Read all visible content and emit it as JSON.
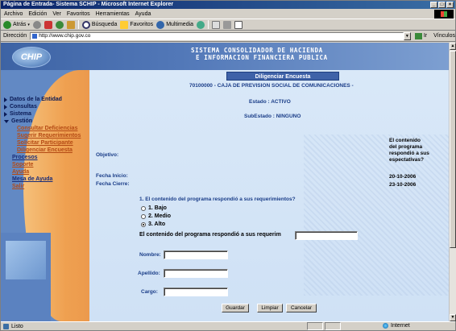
{
  "window": {
    "title": "Página de Entrada- Sistema SCHIP - Microsoft Internet Explorer"
  },
  "menu": [
    "Archivo",
    "Edición",
    "Ver",
    "Favoritos",
    "Herramientas",
    "Ayuda"
  ],
  "toolbar": {
    "back": "Atrás",
    "search": "Búsqueda",
    "favorites": "Favoritos",
    "multimedia": "Multimedia"
  },
  "address": {
    "label": "Dirección",
    "url": "http://www.chip.gov.co",
    "go": "Ir",
    "links": "Vínculos"
  },
  "header": {
    "logo": "CHIP",
    "title_line1": "SISTEMA CONSOLIDADOR DE HACIENDA",
    "title_line2": "E INFORMACION FINANCIERA PUBLICA"
  },
  "nav": {
    "items": [
      "Datos de la Entidad",
      "Consultas",
      "Sistema",
      "Gestión"
    ],
    "sub": [
      "Consultar Deficiencias",
      "Sugerir Requerimientos",
      "Solicitar Participante",
      "Diligenciar Encuesta"
    ],
    "links": [
      "Procesos",
      "Soporte",
      "Ayuda",
      "Mesa de Ayuda",
      "Salir"
    ]
  },
  "form": {
    "tab": "Diligenciar Encuesta",
    "entity": "70100000 - CAJA DE PREVISION SOCIAL DE COMUNICACIONES -",
    "estado": "Estado : ACTIVO",
    "subestado": "SubEstado : NINGUNO",
    "objetivo_label": "Objetivo:",
    "fecha_inicio_label": "Fecha Inicio:",
    "fecha_cierre_label": "Fecha Cierre:",
    "objetivo_value": "El contenido del programa respondió a sus espectativas?",
    "fecha_inicio_value": "20-10-2006",
    "fecha_cierre_value": "23-10-2006",
    "question": "1. El contenido del programa respondió a sus requerimientos?",
    "options": [
      "1. Bajo",
      "2. Medio",
      "3. Alto"
    ],
    "selected_option": 2,
    "question_full": "El contenido del programa respondió a sus requerim",
    "nombre_label": "Nombre:",
    "apellido_label": "Apellido:",
    "cargo_label": "Cargo:",
    "buttons": [
      "Guardar",
      "Limpiar",
      "Cancelar"
    ]
  },
  "status": {
    "left": "Listo",
    "zone": "Internet"
  }
}
